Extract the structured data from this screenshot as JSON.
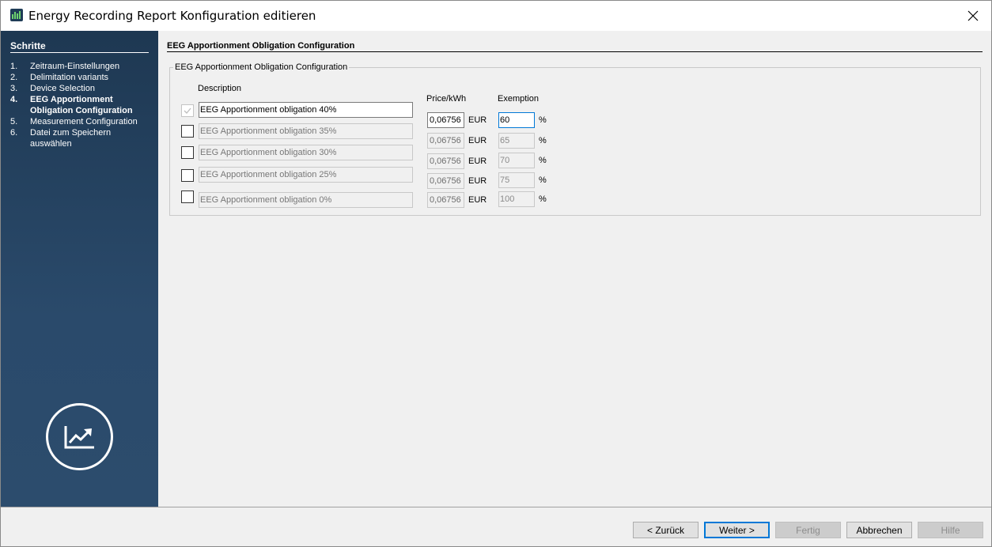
{
  "window": {
    "title": "Energy Recording Report Konfiguration editieren"
  },
  "sidebar": {
    "heading": "Schritte",
    "steps": [
      {
        "num": "1.",
        "label": "Zeitraum-Einstellungen"
      },
      {
        "num": "2.",
        "label": "Delimitation variants"
      },
      {
        "num": "3.",
        "label": "Device Selection"
      },
      {
        "num": "4.",
        "label": "EEG Apportionment Obligation Configuration"
      },
      {
        "num": "5.",
        "label": "Measurement Configuration"
      },
      {
        "num": "6.",
        "label": "Datei zum Speichern auswählen"
      }
    ],
    "active_step": 4,
    "logo_icon": "trend-chart-icon"
  },
  "main": {
    "section_title": "EEG Apportionment Obligation Configuration",
    "group_title": "EEG Apportionment Obligation Configuration",
    "headers": {
      "description": "Description",
      "price": "Price/kWh",
      "exemption": "Exemption"
    },
    "rows": [
      {
        "checked": true,
        "description": "EEG Apportionment obligation 40%",
        "price": "0,06756",
        "unit": "EUR",
        "exemption": "60",
        "pct": "%"
      },
      {
        "checked": false,
        "description": "EEG Apportionment obligation 35%",
        "price": "0,06756",
        "unit": "EUR",
        "exemption": "65",
        "pct": "%"
      },
      {
        "checked": false,
        "description": "EEG Apportionment obligation 30%",
        "price": "0,06756",
        "unit": "EUR",
        "exemption": "70",
        "pct": "%"
      },
      {
        "checked": false,
        "description": "EEG Apportionment obligation 25%",
        "price": "0,06756",
        "unit": "EUR",
        "exemption": "75",
        "pct": "%"
      },
      {
        "checked": false,
        "description": "EEG Apportionment obligation 0%",
        "price": "0,06756",
        "unit": "EUR",
        "exemption": "100",
        "pct": "%"
      }
    ]
  },
  "footer": {
    "back": "< Zurück",
    "next": "Weiter >",
    "finish": "Fertig",
    "cancel": "Abbrechen",
    "help": "Hilfe"
  },
  "colors": {
    "sidebar_bg": "#1e3852",
    "focus_accent": "#0078d7"
  }
}
